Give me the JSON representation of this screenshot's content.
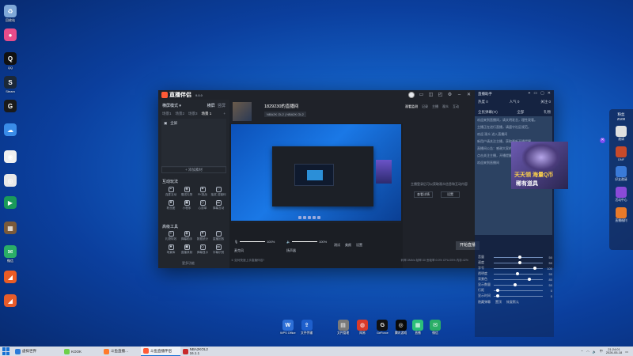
{
  "desktop_icons": [
    {
      "label": "回收站",
      "color": "#7fa8d8",
      "glyph": "♻"
    },
    {
      "label": "",
      "color": "#e84c8a",
      "glyph": "●"
    },
    {
      "label": "QQ",
      "color": "#111111",
      "glyph": "Q"
    },
    {
      "label": "Steam",
      "color": "#1b2838",
      "glyph": "S"
    },
    {
      "label": "",
      "color": "#1a1a1a",
      "glyph": "G"
    },
    {
      "label": "",
      "color": "#3a8ce8",
      "glyph": "☁"
    },
    {
      "label": "",
      "color": "#f0f0f0",
      "glyph": "◉"
    },
    {
      "label": "",
      "color": "#e8e8e8",
      "glyph": "◎"
    },
    {
      "label": "",
      "color": "#1a9a5a",
      "glyph": "▶"
    },
    {
      "label": "",
      "color": "#7a5a3a",
      "glyph": "▦"
    },
    {
      "label": "微信",
      "color": "#2aae67",
      "glyph": "✉"
    },
    {
      "label": "",
      "color": "#ea5c25",
      "glyph": "◢"
    },
    {
      "label": "",
      "color": "#e85c2a",
      "glyph": "◢"
    }
  ],
  "app": {
    "logo": "直播伴侣",
    "version": "9.0.0",
    "title_icons": [
      "user-avatar",
      "message-icon",
      "gift-icon",
      "minimize-icon",
      "settings-icon",
      "maximize-icon",
      "close-icon"
    ],
    "scene_header": "横屏模式",
    "scene_switch": [
      "横屏",
      "竖屏"
    ],
    "scene_tabs": [
      "场景1",
      "场景2",
      "场景3",
      "场景 1",
      "+"
    ],
    "scene_item": "全屏",
    "add_source": "+ 添加素材",
    "interact_title": "互动玩法",
    "interact_items": [
      "连麦互动",
      "赠送礼物",
      "PK挑战",
      "抽奖 送福利",
      "粉丝团",
      "小程序",
      "心愿单",
      "弹幕互动"
    ],
    "tools_title": "高级工具",
    "tools_items": [
      "礼物特效",
      "弹幕助手",
      "数据统计",
      "直播回放",
      "场景库",
      "直播录制",
      "弹幕显示",
      "字幕识别"
    ],
    "more_tools": "更多功能",
    "room_title": "1829230的直播间",
    "game_tags": [
      "NBA2K OL2",
      "NBA2K OL2"
    ],
    "header_actions": [
      "开播设置",
      "分享"
    ],
    "header_stats": [
      "直播监控",
      "0",
      "0"
    ],
    "side_tabs": [
      "观看监测",
      "记录",
      "主播",
      "观众",
      "互动"
    ],
    "side_msg": "主播登录后可以获取观众信息和互动内容",
    "side_buttons": [
      "查看详情",
      "设置"
    ],
    "audio_mic": "麦克风",
    "audio_mic_value": "100%",
    "audio_sys": "扬声器",
    "audio_sys_value": "100%",
    "bottom_actions": [
      "测试",
      "美颜",
      "设置"
    ],
    "live_button": "开始直播",
    "status_left": "① 如何快速上手直播伴侣?",
    "status_right": [
      "码率:3Mb/s",
      "帧率:30",
      "丢帧率:0.0%",
      "CPU:25%",
      "内存:42%"
    ]
  },
  "assist": {
    "title": "直播助手",
    "icons": [
      "pin-icon",
      "minimize-icon",
      "restore-icon",
      "close-icon"
    ],
    "stats": [
      "热度 0",
      "人气 0",
      "关注 0"
    ],
    "tabs": [
      "全民弹幕(!!!)",
      "全部",
      "礼物"
    ],
    "chat_lines": [
      "欢迎来到直播间，请文明发言，理性观看。",
      "主播正在进行直播，请遵守社区规范。",
      "欢迎 观众 进入直播间",
      "新用户请关注主播，获取最新开播提醒",
      "直播间公告：感谢大家的支持与陪伴！",
      "点击关注主播，开播提醒不错过",
      "欢迎来到直播间"
    ],
    "ad_line1": "天天领 海量Q币",
    "ad_line2": "稀有道具",
    "settings": [
      {
        "label": "音量",
        "value": "50",
        "pct": 0.5
      },
      {
        "label": "速度",
        "value": "50",
        "pct": 0.5
      },
      {
        "label": "字号",
        "value": "100",
        "pct": 0.8
      },
      {
        "label": "透明度",
        "value": "50",
        "pct": 0.45
      },
      {
        "label": "背景色",
        "value": "80",
        "pct": 0.7
      },
      {
        "label": "显示数量",
        "value": "50",
        "pct": 0.4
      },
      {
        "label": "行距",
        "value": "0",
        "pct": 0.05
      },
      {
        "label": "显示时间",
        "value": "0",
        "pct": 0.05
      }
    ],
    "footer": [
      "隐藏弹幕",
      "置顶",
      "恢复默认"
    ]
  },
  "right_dock": {
    "rank_label": "粉丝",
    "rank_value": "Z100",
    "items": [
      {
        "label": "邀请",
        "color": "#e0e0e0"
      },
      {
        "label": "DNF",
        "color": "#c84a2a"
      },
      {
        "label": "好友邀请",
        "color": "#3a7ad8"
      },
      {
        "label": "活动中心",
        "color": "#8a4ad8"
      },
      {
        "label": "直播福利",
        "color": "#e87a2a"
      }
    ]
  },
  "dock_icons": [
    {
      "label": "WPS Office",
      "color": "#2d6fd6",
      "glyph": "W"
    },
    {
      "label": "文件传输",
      "color": "#1e5fcc",
      "glyph": "⇪"
    },
    {
      "label": "文件管理",
      "color": "#7a7a7a",
      "glyph": "▤"
    },
    {
      "label": "网易",
      "color": "#d83a2a",
      "glyph": "◍"
    },
    {
      "label": "GeForce",
      "color": "#111111",
      "glyph": "G"
    },
    {
      "label": "腾讯游戏",
      "color": "#0a0a0a",
      "glyph": "◎"
    },
    {
      "label": "直播",
      "color": "#2bc07a",
      "glyph": "▦"
    },
    {
      "label": "微信",
      "color": "#2aae67",
      "glyph": "✉"
    }
  ],
  "taskbar": {
    "items": [
      {
        "label": "虚拟世界",
        "color": "#2a7ad8",
        "active": false
      },
      {
        "label": "KOOK",
        "color": "#6ed04a",
        "active": false
      },
      {
        "label": "斗鱼直播…",
        "color": "#ff7a2a",
        "active": false
      },
      {
        "label": "斗鱼直播伴侣",
        "color": "#ff5a36",
        "active": true
      },
      {
        "label": "NBA2KOL2 16.1.1",
        "color": "#c82a2a",
        "active": false
      }
    ],
    "time": "21:24:01",
    "date": "2026-05-18"
  }
}
